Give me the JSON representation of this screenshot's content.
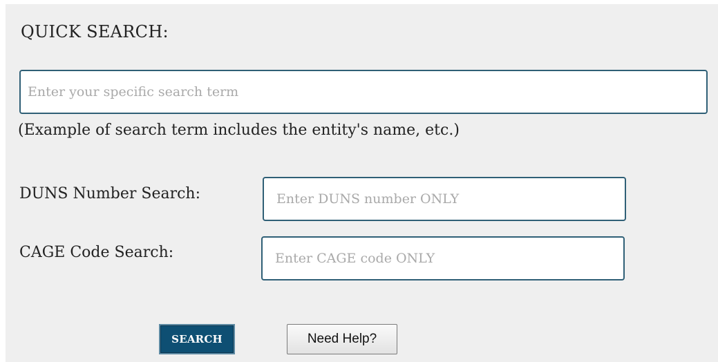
{
  "quick_search": {
    "title": "QUICK SEARCH:",
    "search_term_placeholder": "Enter your specific search term",
    "search_term_value": "",
    "example_text": "(Example of search term includes the entity's name, etc.)"
  },
  "duns_search": {
    "label": "DUNS Number Search:",
    "placeholder": "Enter DUNS number ONLY",
    "value": ""
  },
  "cage_search": {
    "label": "CAGE Code Search:",
    "placeholder": "Enter CAGE code ONLY",
    "value": ""
  },
  "actions": {
    "search_label": "SEARCH",
    "help_label": "Need Help?"
  },
  "colors": {
    "panel_background": "#efefef",
    "input_border": "#2f5f76",
    "search_button": "#0e4f73",
    "placeholder_text": "#a9a9a9"
  }
}
